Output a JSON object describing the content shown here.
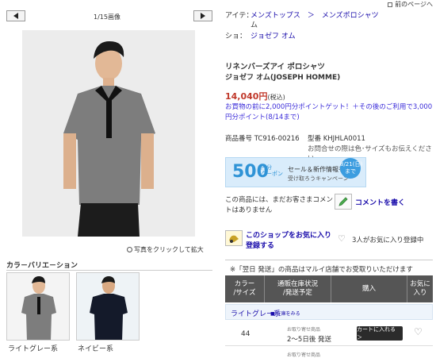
{
  "nav": {
    "back_label": "前のページへ"
  },
  "gallery": {
    "page_count": "1/15画像",
    "zoom_label": "写真をクリックして拡大"
  },
  "colors": {
    "section_title": "カラ－バリエ－ション",
    "items": [
      {
        "label": "ライトグレー系"
      },
      {
        "label": "ネイビー系"
      }
    ]
  },
  "product": {
    "item_label": "アイテ：",
    "item_path": "メンズトップス　＞　メンズポロシャツ",
    "item_path_tail": "ム",
    "shop_label": "ショ：",
    "shop_name": "ジョゼフ オム",
    "title": "リネンバーズアイ ポロシャツ",
    "brand": "ジョゼフ オム(JOSEPH HOMME)",
    "price": "14,040円",
    "price_tax": "(税込)",
    "points": "お買物の前に2,000円分ポイントゲット！＋その後のご利用で3,000円分ポイント(8/14まで)",
    "sku": "商品番号 TC916-00216",
    "model": "型番 KHJHLA0011",
    "inquiry": "お問合せの際は色･サイズもお伝えください"
  },
  "banner": {
    "amount": "500",
    "unit_top": "円分",
    "unit_bottom": "クーポン",
    "sale": "セール＆新作情報を",
    "sub": "受け取ろうキャンペーン",
    "date_top": "8/21(日)",
    "date_bottom": "まで"
  },
  "review": {
    "text": "この商品には、まだお客さまコメントはありません",
    "write_label": "コメントを書く"
  },
  "shop": {
    "fav_label": "このショップをお気に入り登録する",
    "fav_count": "3人がお気に入り登録中"
  },
  "stock": {
    "notice": "※「翌日 発送」の商品はマルイ店舗でお受取りいただけます",
    "headers": {
      "color_size": "カラー\n/サイズ",
      "status": "通販在庫状況\n/発送予定",
      "buy": "購入",
      "fav": "お気に\n入り"
    },
    "color_row": "ライトグレー系",
    "stock_link": "■ 在庫をみる",
    "rows": [
      {
        "size": "44",
        "note": "お取り寄せ商品",
        "ship": "2～5日後 発送",
        "cart": "カートに入れる ＞"
      }
    ],
    "next_note": "お取り寄せ商品"
  }
}
